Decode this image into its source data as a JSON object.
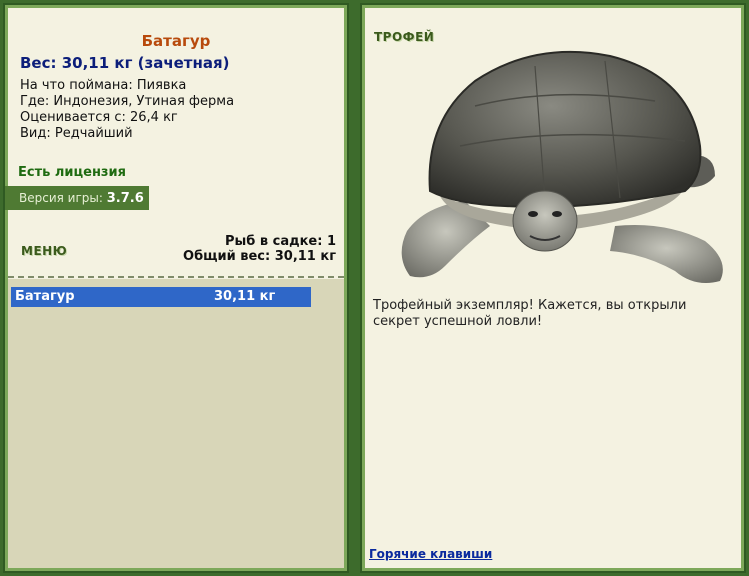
{
  "fish": {
    "name": "Батагур",
    "weight": "Вес: 30,11 кг (зачетная)",
    "bait": "На что поймана: Пиявка",
    "location": "Где: Индонезия, Утиная ферма",
    "value": "Оценивается с: 26,4 кг",
    "rarity": "Вид: Редчайший"
  },
  "license": "Есть лицензия",
  "version": {
    "label": "Версия игры:",
    "number": "3.7.6"
  },
  "menu_label": "МЕНЮ",
  "keepnet": {
    "count": "Рыб в садке: 1",
    "total": "Общий вес: 30,11 кг"
  },
  "catch_list": [
    {
      "name": "Батагур",
      "weight": "30,11 кг"
    }
  ],
  "trophy": {
    "title": "ТРОФЕЙ",
    "description": "Трофейный экземпляр! Кажется, вы открыли секрет успешной ловли!"
  },
  "hotkeys_link": "Горячие клавиши",
  "colors": {
    "background": "#3d6b2c",
    "panel": "#f4f2e1",
    "list_bg": "#d8d6b8",
    "selected": "#2f67c8",
    "fish_name": "#b84a0c",
    "weight": "#0c1e7a",
    "license": "#1f6b11"
  }
}
